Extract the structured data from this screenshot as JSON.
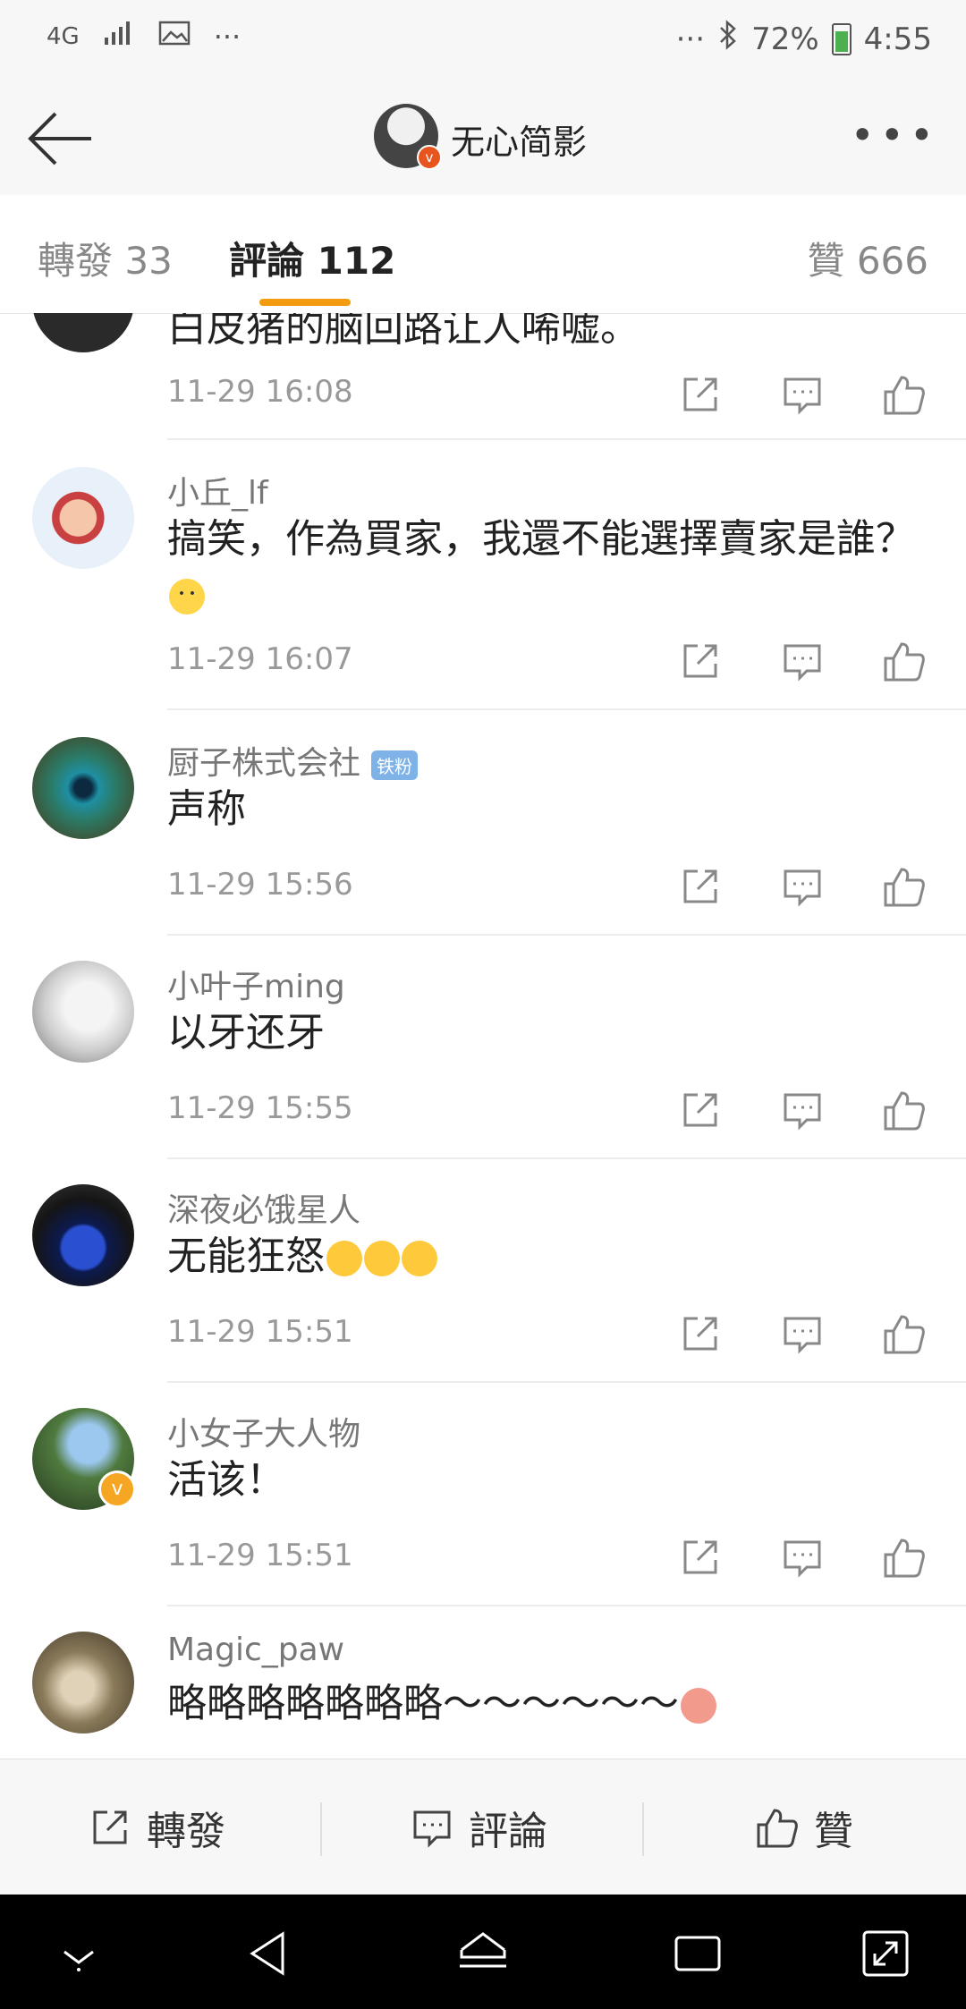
{
  "status_bar": {
    "network": "4G",
    "dots_left": "···",
    "dots_right": "···",
    "battery": "72%",
    "time": "4:55",
    "battery_color": "#4caf50"
  },
  "nav": {
    "title": "无心简影",
    "more": "•••"
  },
  "tabs": {
    "repost": "轉發 33",
    "comments": "評論 112",
    "likes": "贊 666",
    "indicator_color": "#f39c12"
  },
  "comments": [
    {
      "text": "白皮猪的脑回路让人唏嘘。",
      "time": "11-29 16:08"
    },
    {
      "name": "小丘_lf",
      "text": "搞笑，作為買家，我還不能選擇賣家是誰？",
      "time": "11-29 16:07"
    },
    {
      "name": "厨子株式会社",
      "badge": "铁粉",
      "text": "声称",
      "time": "11-29 15:56"
    },
    {
      "name": "小叶子ming",
      "text": "以牙还牙",
      "time": "11-29 15:55"
    },
    {
      "name": "深夜必饿星人",
      "text": "无能狂怒",
      "time": "11-29 15:51"
    },
    {
      "name": "小女子大人物",
      "text": "活该！",
      "time": "11-29 15:51"
    },
    {
      "name": "Magic_paw",
      "text": "略略略略略略略～～～～～～"
    }
  ],
  "action_bar": {
    "repost": "轉發",
    "comment": "評論",
    "like": "贊"
  },
  "icons": {
    "repost": "share-box-icon",
    "comment": "comment-bubble-icon",
    "like": "thumbs-up-icon"
  }
}
